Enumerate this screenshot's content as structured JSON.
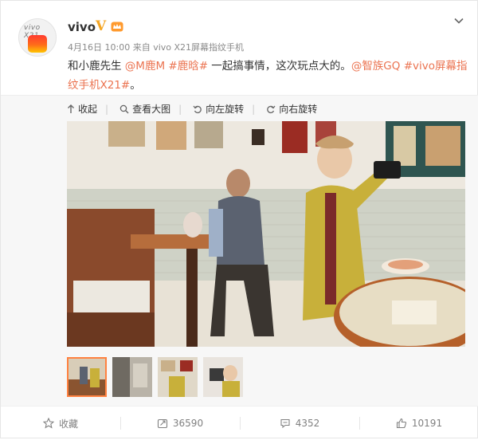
{
  "author": {
    "name": "vivo",
    "verified_mark": "V",
    "avatar_brand_text": "vivo X21"
  },
  "meta": {
    "date": "4月16日 10:00",
    "source": "来自 vivo X21屏幕指纹手机"
  },
  "post": {
    "text_prefix": "和小鹿先生 ",
    "mention_1": "@M鹿M",
    "topic_1": "#鹿晗#",
    "text_middle": " 一起搞事情，这次玩点大的。",
    "mention_2": "@智族GQ",
    "topic_2": "#vivo屏幕指纹手机X21#",
    "text_suffix": "。"
  },
  "media_toolbar": {
    "collapse": "收起",
    "view_large": "查看大图",
    "rotate_left": "向左旋转",
    "rotate_right": "向右旋转"
  },
  "actions": {
    "favorite": "收藏",
    "repost": "36590",
    "comment": "4352",
    "like": "10191"
  },
  "colors": {
    "link": "#eb7350",
    "verified": "#f5a623",
    "thumb_active_border": "#ff8140"
  }
}
